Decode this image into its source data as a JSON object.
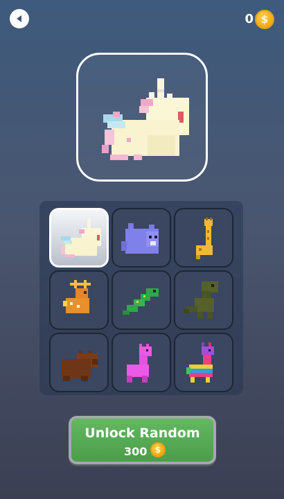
{
  "header": {
    "coins": "0",
    "coin_symbol": "$"
  },
  "characters": [
    {
      "name": "unicorn",
      "selected": true
    },
    {
      "name": "blue-cat",
      "selected": false
    },
    {
      "name": "giraffe",
      "selected": false
    },
    {
      "name": "deer",
      "selected": false
    },
    {
      "name": "green-snake",
      "selected": false
    },
    {
      "name": "dinosaur",
      "selected": false
    },
    {
      "name": "bear",
      "selected": false
    },
    {
      "name": "pink-llama",
      "selected": false
    },
    {
      "name": "pinata-llama",
      "selected": false
    }
  ],
  "unlock": {
    "label": "Unlock Random",
    "price": "300",
    "coin_symbol": "$"
  },
  "colors": {
    "button_green": "#5aad57",
    "coin_gold": "#f0a818",
    "selected_cell": "#ffffff"
  }
}
